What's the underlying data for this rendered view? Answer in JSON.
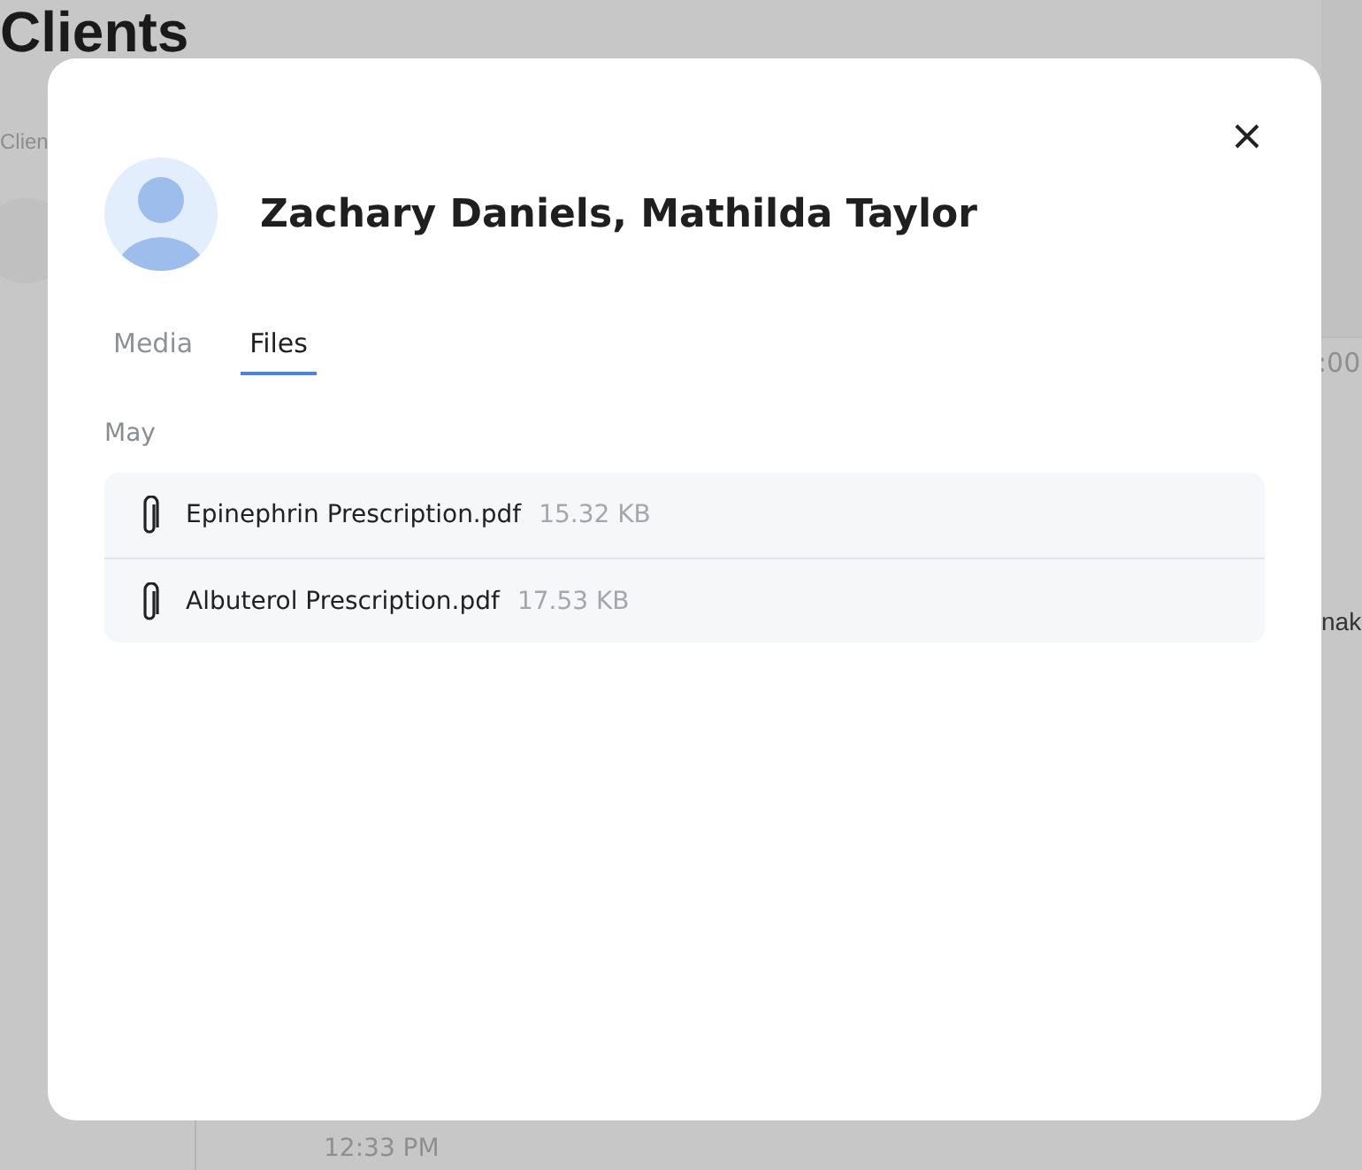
{
  "background": {
    "title": "Clients",
    "subtitle": "Clien",
    "time_fragment": ":00",
    "text_fragment": "nak",
    "timestamp": "12:33 PM"
  },
  "dialog": {
    "title": "Zachary Daniels, Mathilda Taylor",
    "tabs": [
      {
        "label": "Media",
        "selected": false
      },
      {
        "label": "Files",
        "selected": true
      }
    ],
    "groups": [
      {
        "label": "May",
        "files": [
          {
            "name": "Epinephrin Prescription.pdf",
            "size": "15.32 KB"
          },
          {
            "name": "Albuterol Prescription.pdf",
            "size": "17.53 KB"
          }
        ]
      }
    ]
  }
}
